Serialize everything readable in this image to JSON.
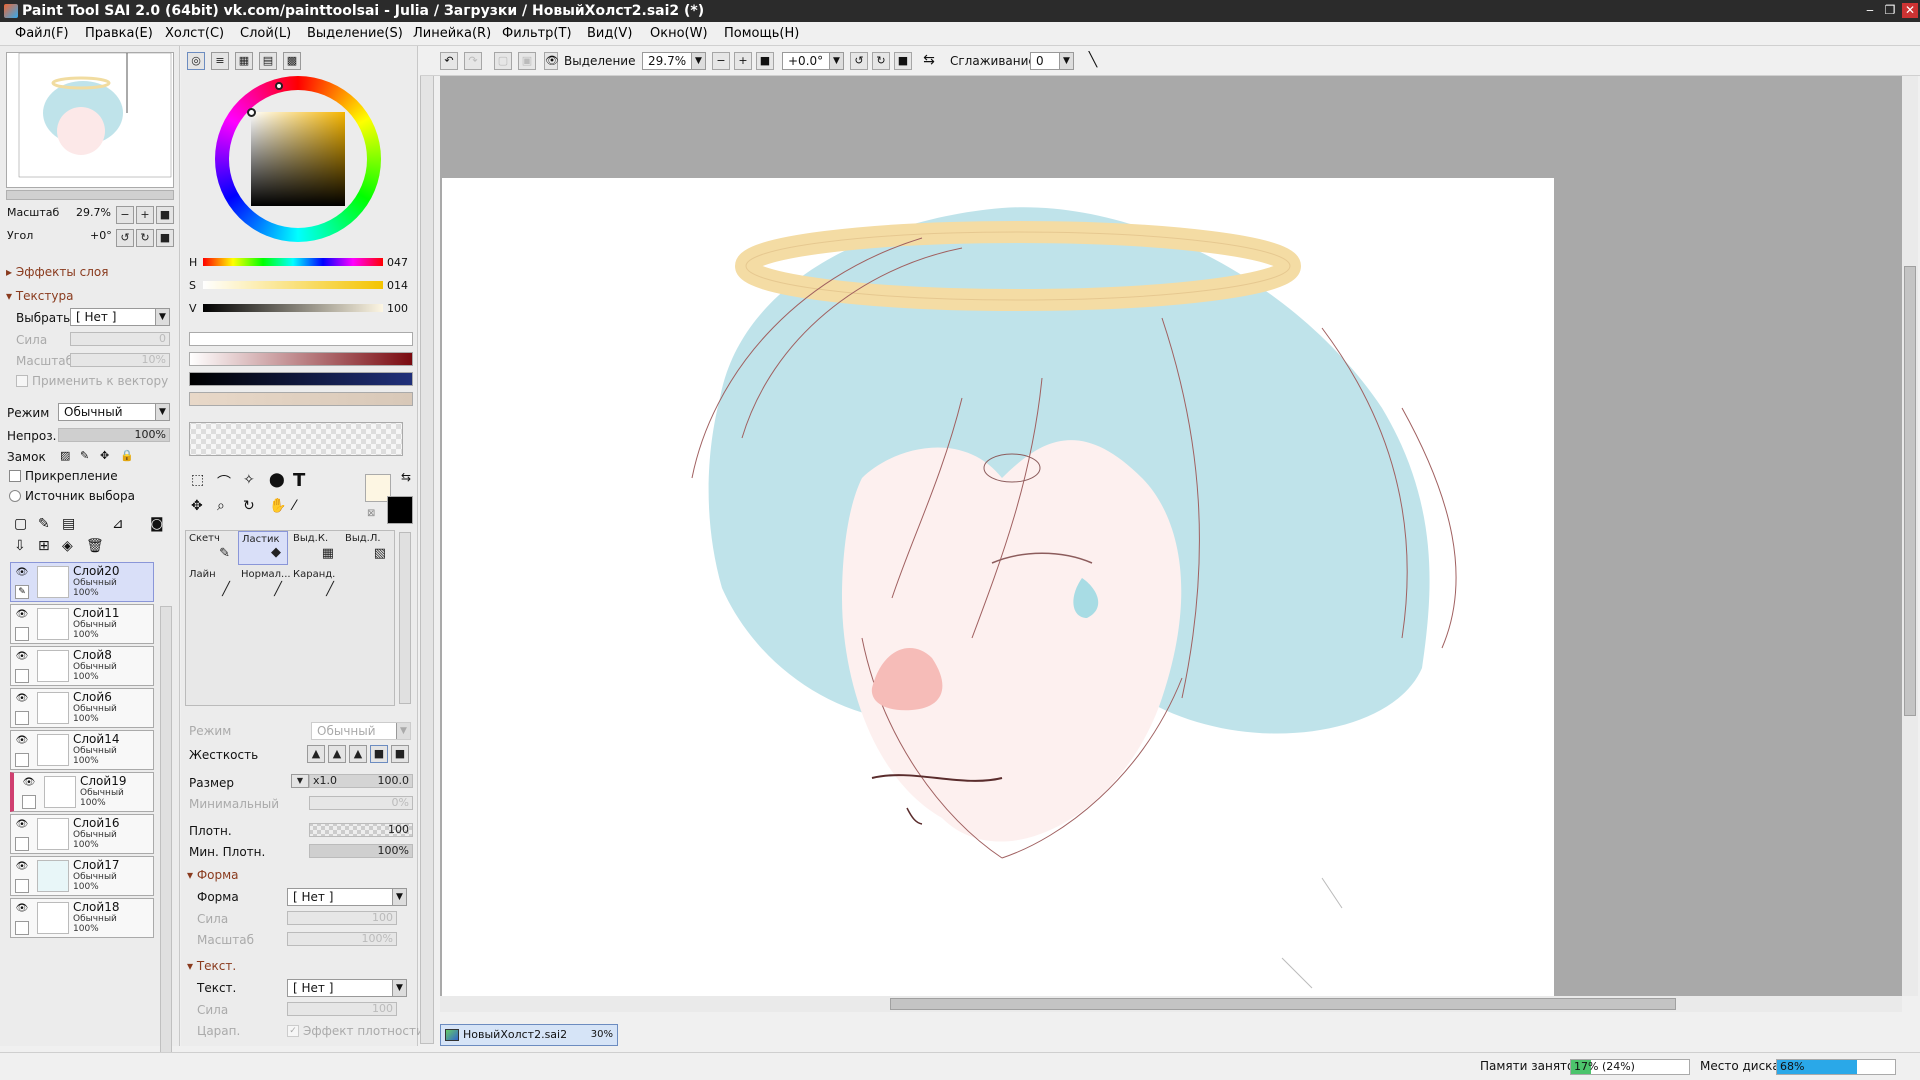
{
  "window": {
    "title": "Paint Tool SAI 2.0 (64bit) vk.com/painttoolsai - Julia / Загрузки / НовыйХолст2.sai2 (*)",
    "controls": [
      "‒",
      "❐",
      "✕"
    ]
  },
  "menu": [
    "Файл(F)",
    "Правка(E)",
    "Холст(C)",
    "Слой(L)",
    "Выделение(S)",
    "Линейка(R)",
    "Фильтр(T)",
    "Вид(V)",
    "Окно(W)",
    "Помощь(H)"
  ],
  "navigator": {
    "zoom_label": "Масштаб",
    "zoom_value": "29.7%",
    "angle_label": "Угол",
    "angle_value": "+0°"
  },
  "layer_props": {
    "effects_section": "Эффекты слоя",
    "texture_section": "Текстура",
    "select_label": "Выбрать",
    "select_value": "[ Нет ]",
    "strength_label": "Сила",
    "strength_value": "0",
    "scale_label": "Масштаб",
    "scale_value": "10%",
    "apply_vector_label": "Применить к вектору",
    "mode_label": "Режим",
    "mode_value": "Обычный",
    "opacity_label": "Непроз.",
    "opacity_value": "100%",
    "lock_label": "Замок",
    "clipping_label": "Прикрепление",
    "selection_source_label": "Источник выбора"
  },
  "layers": [
    {
      "name": "Слой20",
      "mode": "Обычный",
      "opacity": "100%",
      "selected": true
    },
    {
      "name": "Слой11",
      "mode": "Обычный",
      "opacity": "100%"
    },
    {
      "name": "Слой8",
      "mode": "Обычный",
      "opacity": "100%"
    },
    {
      "name": "Слой6",
      "mode": "Обычный",
      "opacity": "100%"
    },
    {
      "name": "Слой14",
      "mode": "Обычный",
      "opacity": "100%"
    },
    {
      "name": "Слой19",
      "mode": "Обычный",
      "opacity": "100%"
    },
    {
      "name": "Слой16",
      "mode": "Обычный",
      "opacity": "100%"
    },
    {
      "name": "Слой17",
      "mode": "Обычный",
      "opacity": "100%"
    },
    {
      "name": "Слой18",
      "mode": "Обычный",
      "opacity": "100%"
    }
  ],
  "color": {
    "h_label": "H",
    "h_value": "047",
    "s_label": "S",
    "s_value": "014",
    "v_label": "V",
    "v_value": "100",
    "primary": "#fdf6e3",
    "secondary": "#000000"
  },
  "tools": [
    {
      "name": "Скетч",
      "icon": "✎"
    },
    {
      "name": "Ластик",
      "icon": "◆",
      "selected": true
    },
    {
      "name": "Выд.К.",
      "icon": "▦"
    },
    {
      "name": "Выд.Л.",
      "icon": "▧"
    },
    {
      "name": "Лайн",
      "icon": "╱"
    },
    {
      "name": "Нормал...",
      "icon": "╱"
    },
    {
      "name": "Каранд.",
      "icon": "╱"
    }
  ],
  "brush": {
    "mode_label": "Режим",
    "mode_value": "Обычный",
    "hardness_label": "Жесткость",
    "size_label": "Размер",
    "size_mult": "x1.0",
    "size_value": "100.0",
    "min_label": "Минимальный",
    "min_value": "0%",
    "density_label": "Плотн.",
    "density_value": "100",
    "min_density_label": "Мин. Плотн.",
    "min_density_value": "100%",
    "shape_section": "Форма",
    "shape_label": "Форма",
    "shape_value": "[ Нет ]",
    "shape_strength_label": "Сила",
    "shape_strength_value": "100",
    "shape_scale_label": "Масштаб",
    "shape_scale_value": "100%",
    "texture_section": "Текст.",
    "texture_label": "Текст.",
    "texture_value": "[ Нет ]",
    "texture_strength_label": "Сила",
    "texture_strength_value": "100",
    "scratch_label": "Царап.",
    "density_effect_label": "Эффект плотности"
  },
  "toolbar": {
    "selection_label": "Выделение",
    "zoom_value": "29.7%",
    "angle_value": "+0.0°",
    "smoothing_label": "Сглаживание",
    "smoothing_value": "0"
  },
  "document_tab": {
    "name": "НовыйХолст2.sai2",
    "zoom": "30%"
  },
  "status": {
    "memory_label": "Памяти занято",
    "memory_value": "17% (24%)",
    "memory_fraction": 0.17,
    "disk_label": "Место диска",
    "disk_value": "68%",
    "disk_fraction": 0.68
  }
}
